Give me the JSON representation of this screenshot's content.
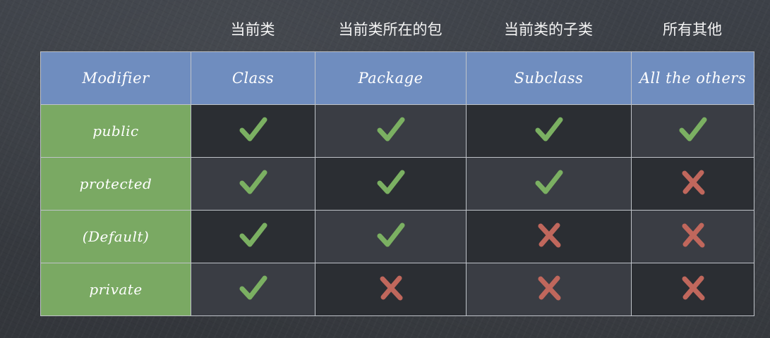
{
  "header_zh": [
    "当前类",
    "当前类所在的包",
    "当前类的子类",
    "所有其他"
  ],
  "table": {
    "columns": [
      "Modifier",
      "Class",
      "Package",
      "Subclass",
      "All the others"
    ],
    "rows": [
      {
        "label": "public",
        "access": [
          "yes",
          "yes",
          "yes",
          "yes"
        ]
      },
      {
        "label": "protected",
        "access": [
          "yes",
          "yes",
          "yes",
          "no"
        ]
      },
      {
        "label": "(Default)",
        "access": [
          "yes",
          "yes",
          "no",
          "no"
        ]
      },
      {
        "label": "private",
        "access": [
          "yes",
          "no",
          "no",
          "no"
        ]
      }
    ]
  },
  "colors": {
    "header_blue": "#6f8dbf",
    "label_green": "#7aa963",
    "check_green": "#7bb062",
    "cross_red": "#c0675c",
    "board": "#3a3d42"
  },
  "icons": {
    "yes": "check-icon",
    "no": "cross-icon"
  }
}
